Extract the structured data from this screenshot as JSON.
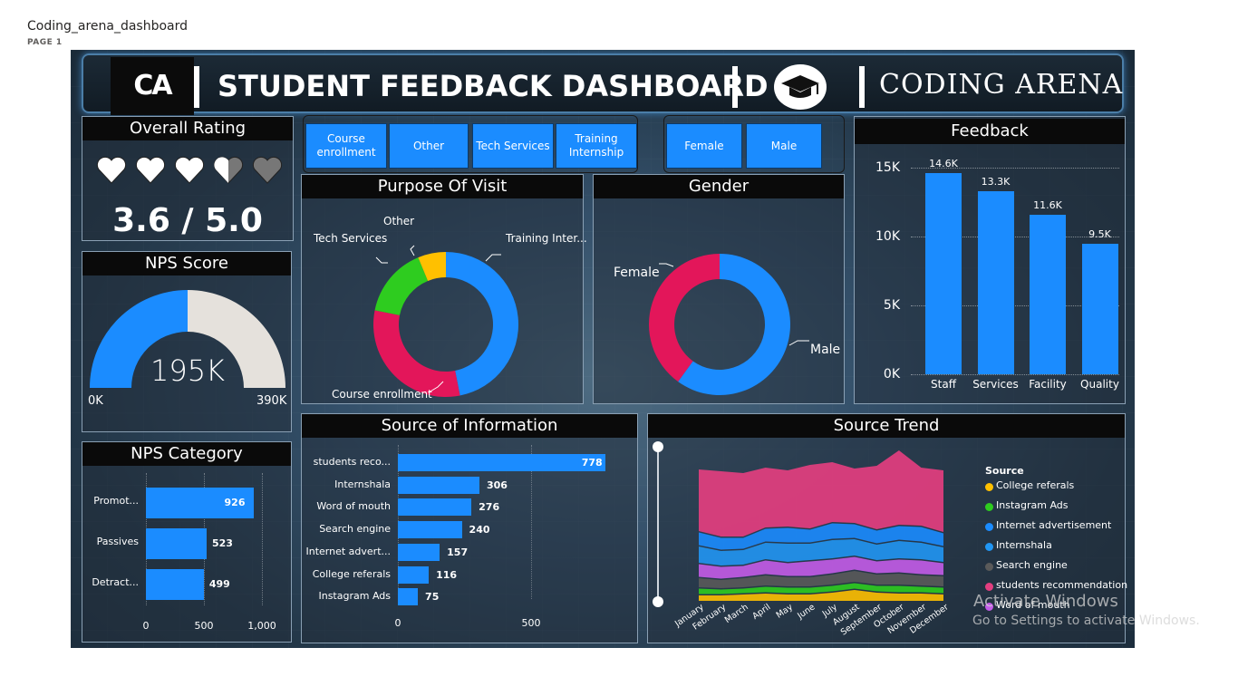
{
  "report": {
    "title": "Coding_arena_dashboard",
    "page": "PAGE 1"
  },
  "header": {
    "logo": "CA",
    "title": "STUDENT FEEDBACK DASHBOARD",
    "brand": "CODING ARENA",
    "logo_icon": "graduation-cap-icon"
  },
  "slicers": {
    "purpose": [
      "Course enrollment",
      "Other",
      "Tech Services",
      "Training Internship"
    ],
    "gender": [
      "Female",
      "Male"
    ]
  },
  "overall_rating": {
    "title": "Overall Rating",
    "value_text": "3.6 / 5.0",
    "value": 3.6,
    "max": 5.0
  },
  "nps_score": {
    "title": "NPS Score",
    "value_label": "195K",
    "min_label": "0K",
    "max_label": "390K",
    "value": 195,
    "max": 390,
    "fill_color": "#1b8cff",
    "rest_color": "#e5e1dc"
  },
  "nps_category": {
    "title": "NPS Category",
    "categories": [
      "Promot...",
      "Passives",
      "Detract..."
    ],
    "values": [
      926,
      523,
      499
    ],
    "value_labels": [
      "926",
      "523",
      "499"
    ],
    "ticks": [
      "0",
      "500",
      "1,000"
    ]
  },
  "purpose_of_visit": {
    "title": "Purpose Of Visit",
    "labels": [
      "Training Inter...",
      "Course enrollment",
      "Tech Services",
      "Other"
    ],
    "colors": [
      "#1b8cff",
      "#e3165a",
      "#2ecc1f",
      "#ffc000"
    ]
  },
  "gender": {
    "title": "Gender",
    "labels": [
      "Male",
      "Female"
    ],
    "colors": [
      "#1b8cff",
      "#e3165a"
    ]
  },
  "feedback": {
    "title": "Feedback",
    "categories": [
      "Staff",
      "Services",
      "Facility",
      "Quality"
    ],
    "values": [
      14.6,
      13.3,
      11.6,
      9.5
    ],
    "value_labels": [
      "14.6K",
      "13.3K",
      "11.6K",
      "9.5K"
    ],
    "ticks": [
      "15K",
      "10K",
      "5K",
      "0K"
    ]
  },
  "source_info": {
    "title": "Source of Information",
    "categories": [
      "students reco...",
      "Internshala",
      "Word of mouth",
      "Search engine",
      "Internet advert...",
      "College referals",
      "Instagram Ads"
    ],
    "values": [
      778,
      306,
      276,
      240,
      157,
      116,
      75
    ],
    "value_labels": [
      "778",
      "306",
      "276",
      "240",
      "157",
      "116",
      "75"
    ],
    "ticks": [
      "0",
      "500"
    ]
  },
  "source_trend": {
    "title": "Source Trend",
    "legend_title": "Source",
    "legend": [
      {
        "name": "College referals",
        "color": "#ffc000"
      },
      {
        "name": "Instagram Ads",
        "color": "#2ecc1f"
      },
      {
        "name": "Internet advertisement",
        "color": "#1b8cff"
      },
      {
        "name": "Internshala",
        "color": "#2196f3"
      },
      {
        "name": "Search engine",
        "color": "#5a5a5a"
      },
      {
        "name": "students recommendation",
        "color": "#e33e7f"
      },
      {
        "name": "Word of mouth",
        "color": "#c45ce8"
      }
    ],
    "months": [
      "January",
      "February",
      "March",
      "April",
      "May",
      "June",
      "July",
      "August",
      "September",
      "October",
      "November",
      "December"
    ]
  },
  "windows": {
    "line1": "Activate Windows",
    "line2": "Go to Settings to activate Windows."
  },
  "chart_data": [
    {
      "type": "bar",
      "title": "Feedback",
      "categories": [
        "Staff",
        "Services",
        "Facility",
        "Quality"
      ],
      "values": [
        14600,
        13300,
        11600,
        9500
      ],
      "ylim": [
        0,
        15000
      ]
    },
    {
      "type": "bar",
      "title": "NPS Category",
      "categories": [
        "Promot...",
        "Passives",
        "Detract..."
      ],
      "values": [
        926,
        523,
        499
      ],
      "xlim": [
        0,
        1000
      ]
    },
    {
      "type": "bar",
      "title": "Source of Information",
      "categories": [
        "students reco...",
        "Internshala",
        "Word of mouth",
        "Search engine",
        "Internet advert...",
        "College referals",
        "Instagram Ads"
      ],
      "values": [
        778,
        306,
        276,
        240,
        157,
        116,
        75
      ]
    },
    {
      "type": "pie",
      "title": "Purpose Of Visit",
      "categories": [
        "Training Inter...",
        "Course enrollment",
        "Tech Services",
        "Other"
      ],
      "values": [
        45,
        30,
        15,
        6
      ]
    },
    {
      "type": "pie",
      "title": "Gender",
      "categories": [
        "Male",
        "Female"
      ],
      "values": [
        60,
        40
      ]
    }
  ]
}
